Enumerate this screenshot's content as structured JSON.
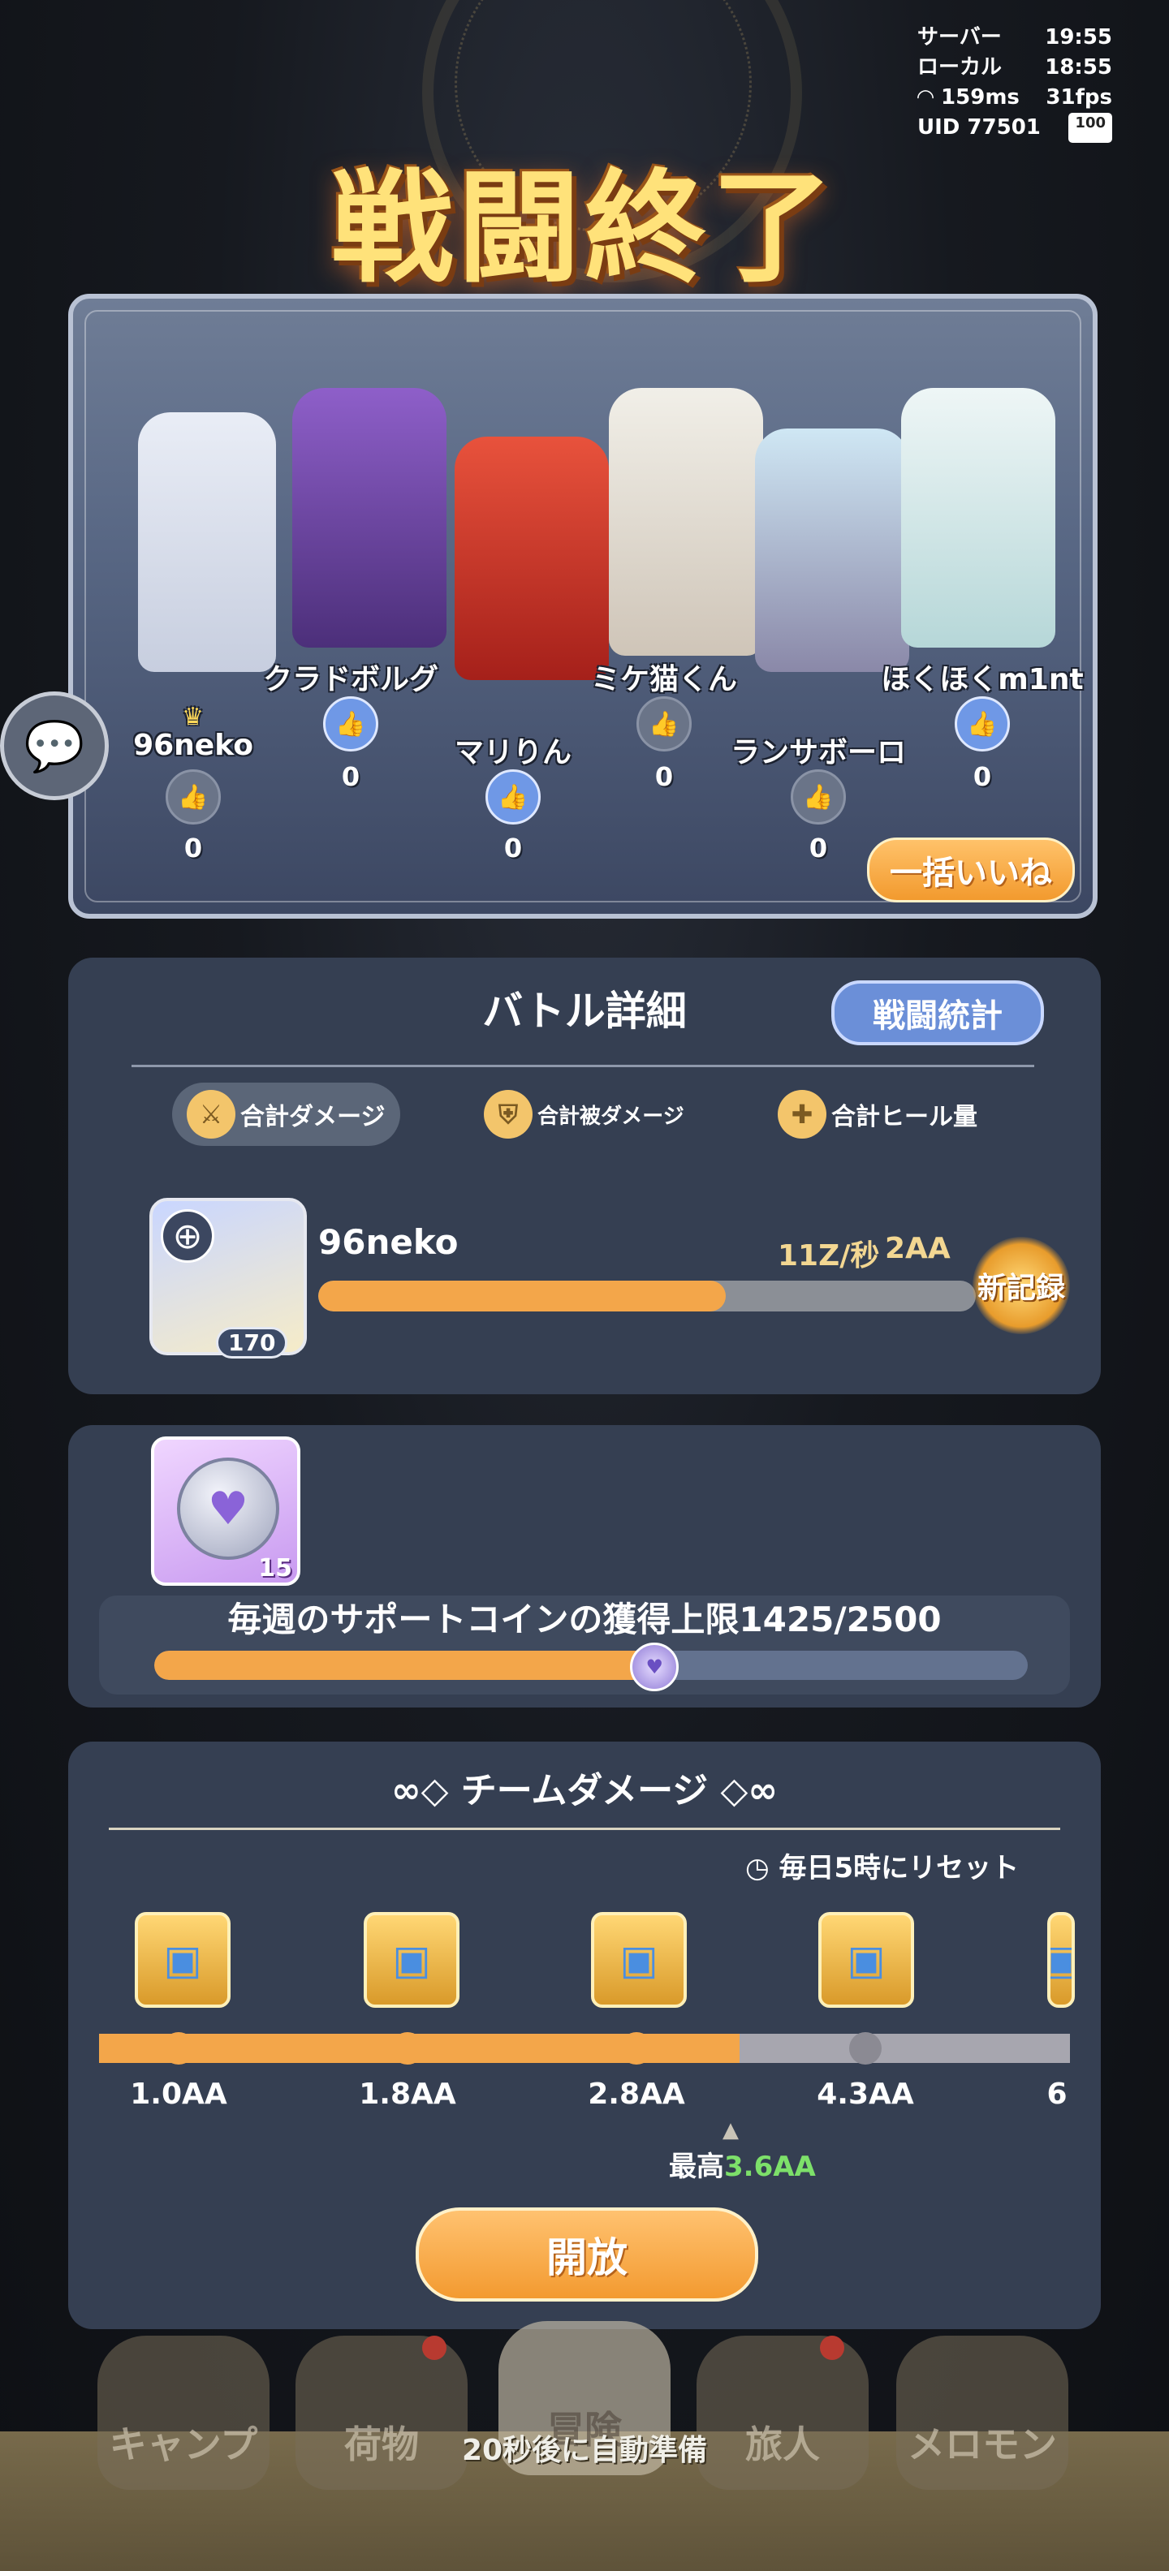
{
  "status": {
    "server_label": "サーバー",
    "server_time": "19:55",
    "local_label": "ローカル",
    "local_time": "18:55",
    "ping": "159ms",
    "fps": "31fps",
    "uid_label": "UID 77501",
    "battery": "100"
  },
  "title": "戦闘終了",
  "players": [
    {
      "name": "96neko",
      "likes": "0",
      "liked": false,
      "crown": true
    },
    {
      "name": "クラドボルグ",
      "likes": "0",
      "liked": true
    },
    {
      "name": "マリりん",
      "likes": "0",
      "liked": true
    },
    {
      "name": "ミケ猫くん",
      "likes": "0",
      "liked": false
    },
    {
      "name": "ランサボーロ",
      "likes": "0",
      "liked": false
    },
    {
      "name": "ほくほくm1nt",
      "likes": "0",
      "liked": true
    }
  ],
  "bulk_like_label": "一括いいね",
  "details": {
    "title": "バトル詳細",
    "stats_button": "戦闘統計",
    "tabs": [
      "合計ダメージ",
      "合計被ダメージ",
      "合計ヒール量"
    ],
    "active_tab": 0,
    "entry": {
      "name": "96neko",
      "level": "170",
      "dps": "11Z/秒",
      "total": "2AA",
      "progress": 0.62,
      "record_badge": "新記録"
    }
  },
  "support_coin": {
    "count": "15",
    "label": "毎週のサポートコインの獲得上限1425/2500",
    "current": 1425,
    "max": 2500
  },
  "team_damage": {
    "title": "チームダメージ",
    "reset_note": "毎日5時にリセット",
    "tiers": [
      "1.0AA",
      "1.8AA",
      "2.8AA",
      "4.3AA",
      "6"
    ],
    "progress": 0.66,
    "best_label": "最高",
    "best_value": "3.6AA",
    "open_label": "開放"
  },
  "nav": [
    "キャンプ",
    "荷物",
    "冒険",
    "旅人",
    "メロモン"
  ],
  "auto_ready": "20秒後に自動準備",
  "colors": {
    "accent": "#f3a64a",
    "card": "#353f52",
    "like_on": "#6f98e6",
    "best": "#7de06a"
  }
}
